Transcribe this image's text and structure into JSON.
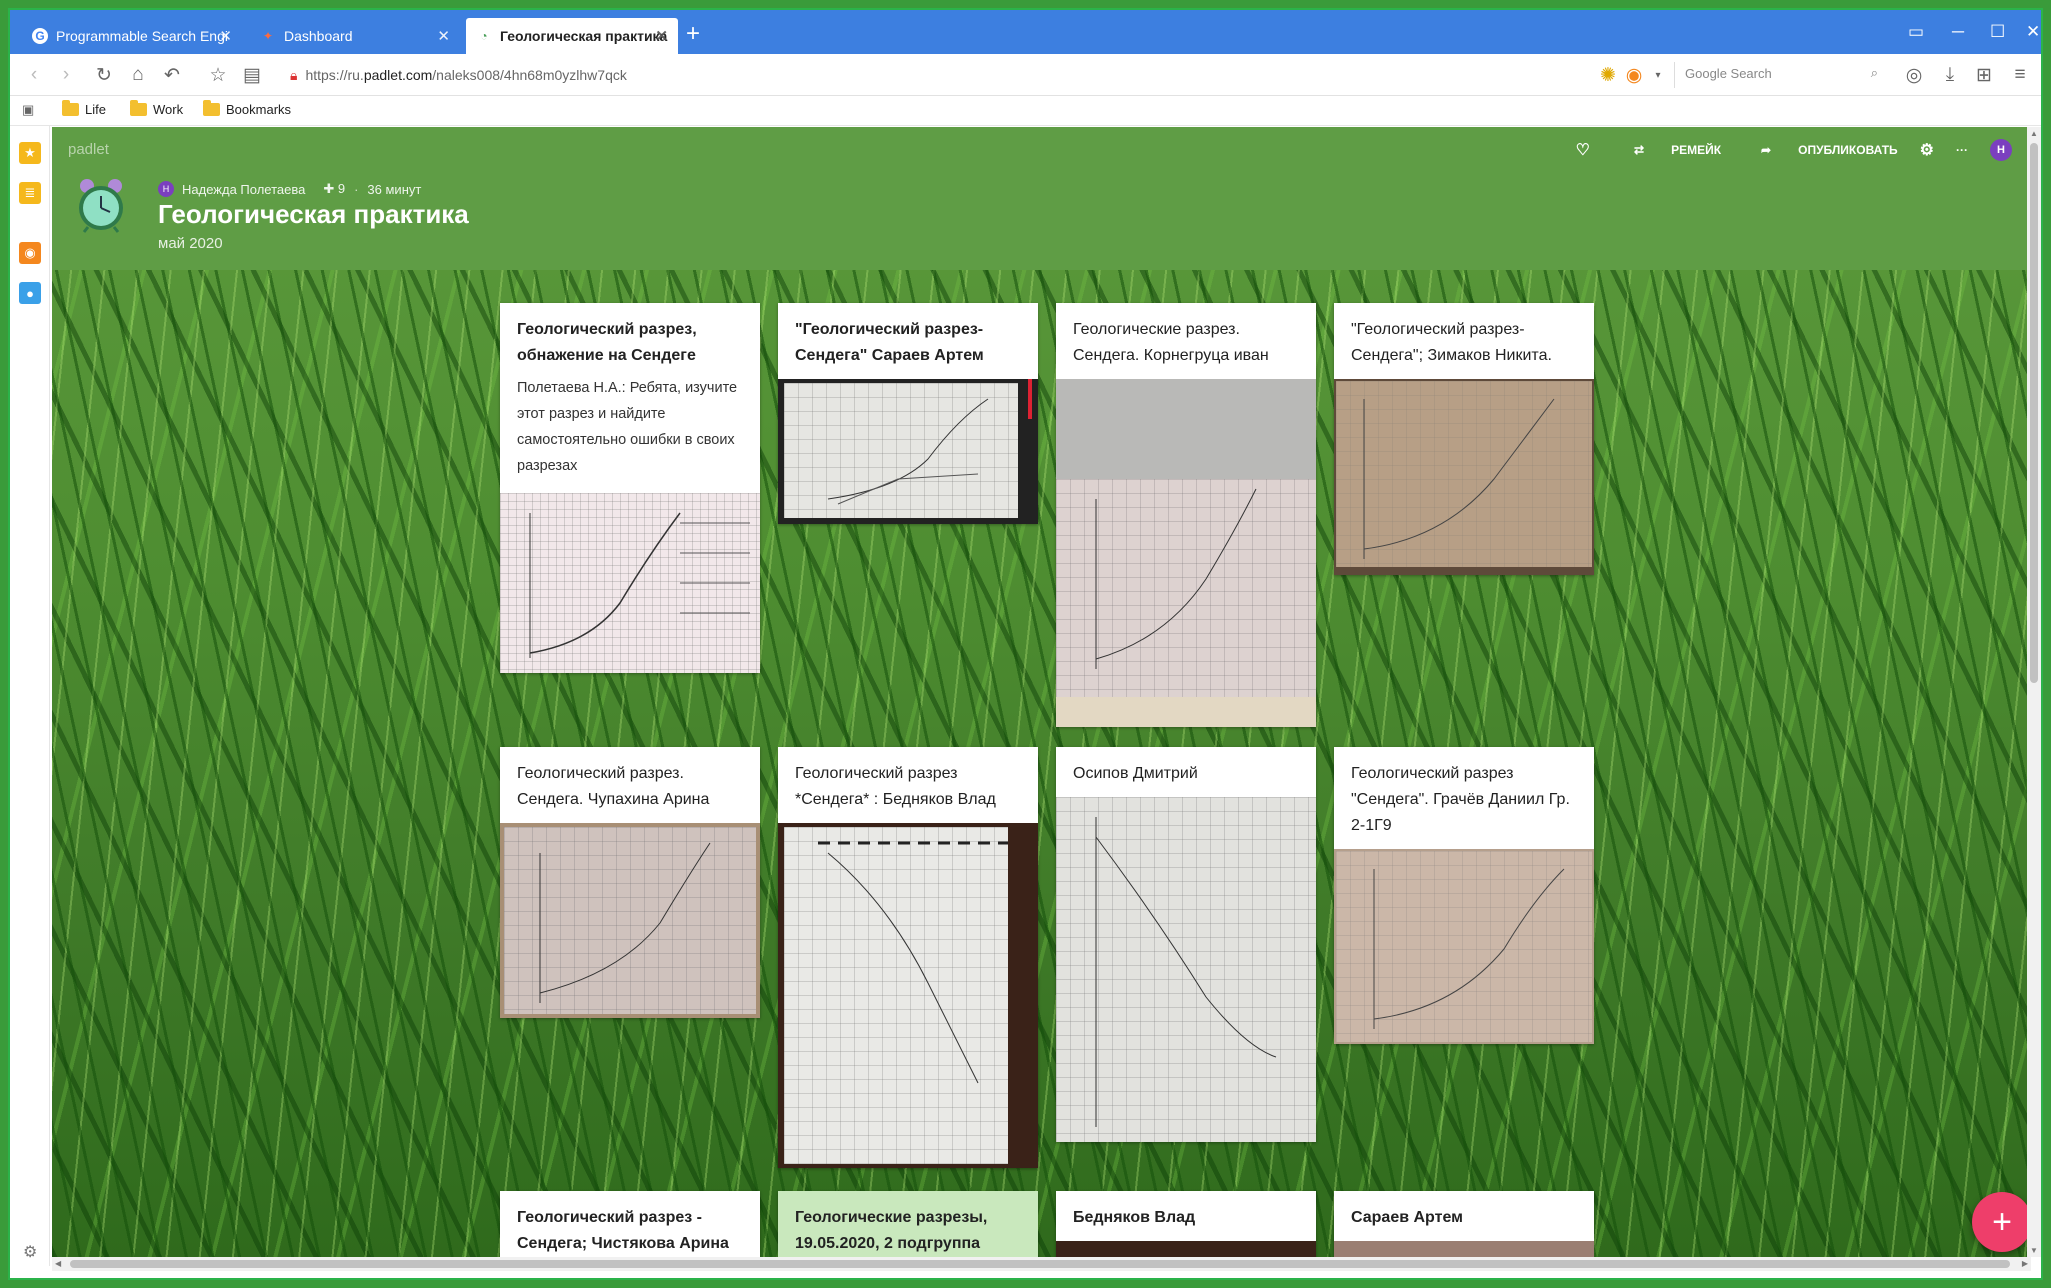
{
  "browser": {
    "tabs": [
      {
        "label": "Programmable Search Engi",
        "icon": "google-icon"
      },
      {
        "label": "Dashboard",
        "icon": "dashboard-icon"
      },
      {
        "label": "Геологическая практика",
        "icon": "padlet-icon"
      }
    ],
    "url_prefix": "https://ru.",
    "url_domain": "padlet.com",
    "url_path": "/naleks008/4hn68m0yzlhw7qck",
    "search_placeholder": "Google Search",
    "bookmarks": [
      "Life",
      "Work",
      "Bookmarks"
    ]
  },
  "padlet": {
    "brand": "padlet",
    "author": "Надежда Полетаева",
    "author_initial": "Н",
    "likes": "✚ 9",
    "time_ago": "36 минут",
    "title": "Геологическая практика",
    "subtitle": "май 2020",
    "actions": {
      "remake": "РЕМЕЙК",
      "publish": "ОПУБЛИКОВАТЬ",
      "more": "···",
      "user_initial": "Н"
    },
    "add_button": "+"
  },
  "cards": [
    {
      "title": "Геологический разрез, обнажение на Сендеге",
      "body": "Полетаева Н.А.: Ребята, изучите этот разрез и  найдите самостоятельно ошибки в своих разрезах"
    },
    {
      "title": "\"Геологический разрез-Сендега\" Сараев Артем"
    },
    {
      "title": "Геологические разрез. Сендега. Корнегруца иван"
    },
    {
      "title": "\"Геологический разрез-Сендега\"; Зимаков Никита."
    },
    {
      "title": "Геологический разрез. Сендега. Чупахина Арина"
    },
    {
      "title": "Геологический разрез *Сендега* : Бедняков Влад"
    },
    {
      "title": "Осипов Дмитрий"
    },
    {
      "title": "Геологический разрез \"Сендега\". Грачёв Даниил Гр. 2-1Г9"
    },
    {
      "title": "Геологический разрез - Сендега; Чистякова Арина"
    },
    {
      "title": "Геологические разрезы, 19.05.2020, 2 подгруппа"
    },
    {
      "title": "Бедняков Влад"
    },
    {
      "title": "Сараев Артем"
    }
  ]
}
